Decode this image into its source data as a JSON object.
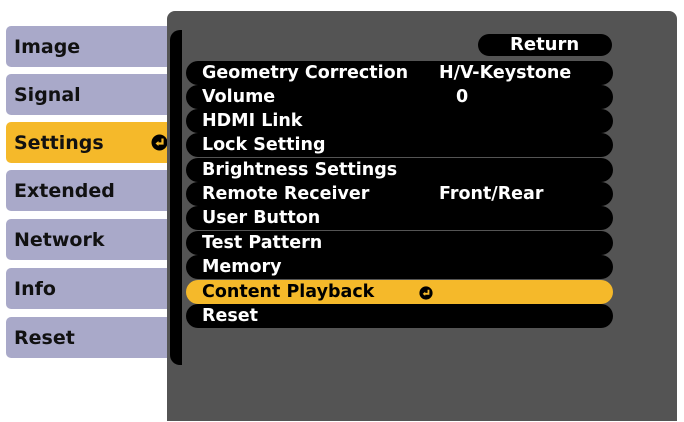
{
  "sidebar": {
    "tabs": [
      {
        "label": "Image",
        "selected": false
      },
      {
        "label": "Signal",
        "selected": false
      },
      {
        "label": "Settings",
        "selected": true
      },
      {
        "label": "Extended",
        "selected": false
      },
      {
        "label": "Network",
        "selected": false
      },
      {
        "label": "Info",
        "selected": false
      },
      {
        "label": "Reset",
        "selected": false
      }
    ]
  },
  "menu": {
    "return_label": "Return",
    "items": [
      {
        "label": "Geometry Correction",
        "value": "H/V-Keystone"
      },
      {
        "label": "Volume",
        "value": "0"
      },
      {
        "label": "HDMI Link",
        "value": ""
      },
      {
        "label": "Lock Setting",
        "value": ""
      },
      {
        "label": "Brightness Settings",
        "value": ""
      },
      {
        "label": "Remote Receiver",
        "value": "Front/Rear"
      },
      {
        "label": "User Button",
        "value": ""
      },
      {
        "label": "Test Pattern",
        "value": ""
      },
      {
        "label": "Memory",
        "value": ""
      },
      {
        "label": "Content Playback",
        "value": "",
        "selected": true
      },
      {
        "label": "Reset",
        "value": ""
      }
    ]
  },
  "colors": {
    "tab_bg": "#a9a9c9",
    "selected_bg": "#f5b92a",
    "panel_bg": "#545454",
    "row_bg": "#000000"
  },
  "icons": {
    "enter": "enter-icon"
  }
}
